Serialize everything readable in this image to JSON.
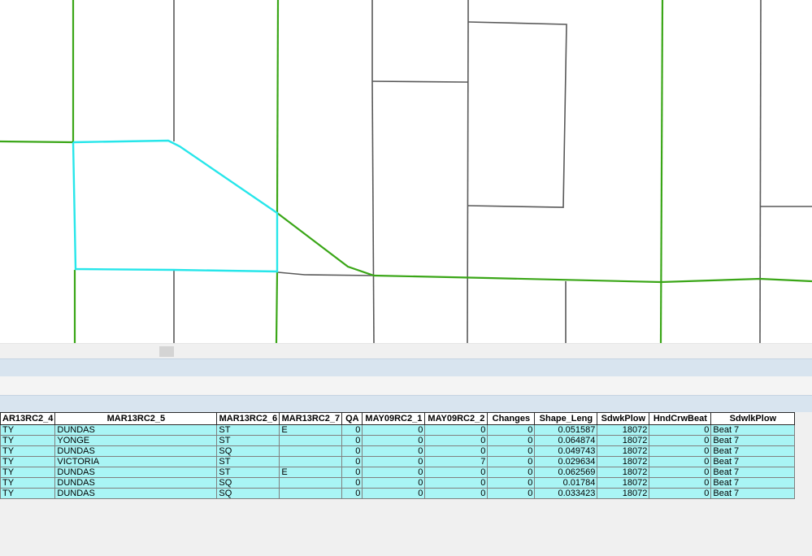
{
  "map": {
    "colors": {
      "street_green": "#3aa617",
      "street_gray": "#595959",
      "selection_cyan": "#27e6ea",
      "background": "#ffffff"
    }
  },
  "colors": {
    "table_row_bg": "#a9f5f5",
    "table_header_bg": "#ffffff",
    "bar_bg": "#d8e4ef"
  },
  "table": {
    "columns": [
      "AR13RC2_4",
      "MAR13RC2_5",
      "MAR13RC2_6",
      "MAR13RC2_7",
      "QA",
      "MAY09RC2_1",
      "MAY09RC2_2",
      "Changes",
      "Shape_Leng",
      "SdwkPlow",
      "HndCrwBeat",
      "SdwlkPlow"
    ],
    "rows": [
      [
        "TY",
        "DUNDAS",
        "ST",
        "E",
        "0",
        "0",
        "0",
        "0",
        "0.051587",
        "18072",
        "0",
        "Beat 7"
      ],
      [
        "TY",
        "YONGE",
        "ST",
        "",
        "0",
        "0",
        "0",
        "0",
        "0.064874",
        "18072",
        "0",
        "Beat 7"
      ],
      [
        "TY",
        "DUNDAS",
        "SQ",
        "",
        "0",
        "0",
        "0",
        "0",
        "0.049743",
        "18072",
        "0",
        "Beat 7"
      ],
      [
        "TY",
        "VICTORIA",
        "ST",
        "",
        "0",
        "0",
        "7",
        "0",
        "0.029634",
        "18072",
        "0",
        "Beat 7"
      ],
      [
        "TY",
        "DUNDAS",
        "ST",
        "E",
        "0",
        "0",
        "0",
        "0",
        "0.062569",
        "18072",
        "0",
        "Beat 7"
      ],
      [
        "TY",
        "DUNDAS",
        "SQ",
        "",
        "0",
        "0",
        "0",
        "0",
        "0.01784",
        "18072",
        "0",
        "Beat 7"
      ],
      [
        "TY",
        "DUNDAS",
        "SQ",
        "",
        "0",
        "0",
        "0",
        "0",
        "0.033423",
        "18072",
        "0",
        "Beat 7"
      ]
    ]
  }
}
